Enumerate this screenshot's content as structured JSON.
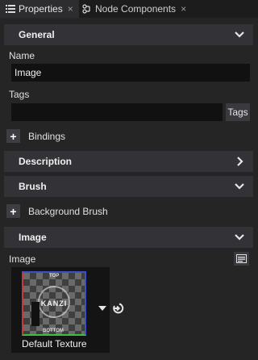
{
  "tabs": [
    {
      "label": "Properties",
      "icon": "list-icon",
      "close": "×"
    },
    {
      "label": "Node Components",
      "icon": "node-components-icon",
      "close": "×"
    }
  ],
  "sections": {
    "general": {
      "title": "General",
      "state": "expanded"
    },
    "description": {
      "title": "Description",
      "state": "collapsed"
    },
    "brush": {
      "title": "Brush",
      "state": "expanded"
    },
    "image": {
      "title": "Image",
      "state": "expanded"
    }
  },
  "general": {
    "name_label": "Name",
    "name_value": "Image",
    "tags_label": "Tags",
    "tags_value": "",
    "tags_button": "Tags",
    "bindings_label": "Bindings",
    "add_symbol": "+"
  },
  "brush": {
    "background_brush_label": "Background Brush",
    "add_symbol": "+"
  },
  "image": {
    "image_label": "Image",
    "texture_name": "Default Texture",
    "thumbnail_text": {
      "top": "TOP",
      "bottom": "BOTTOM",
      "logo": "KANZI"
    }
  },
  "colors": {
    "background": "#252526",
    "section_header": "#333337",
    "input_background": "#111111",
    "tab_active": "#2d2d30"
  }
}
